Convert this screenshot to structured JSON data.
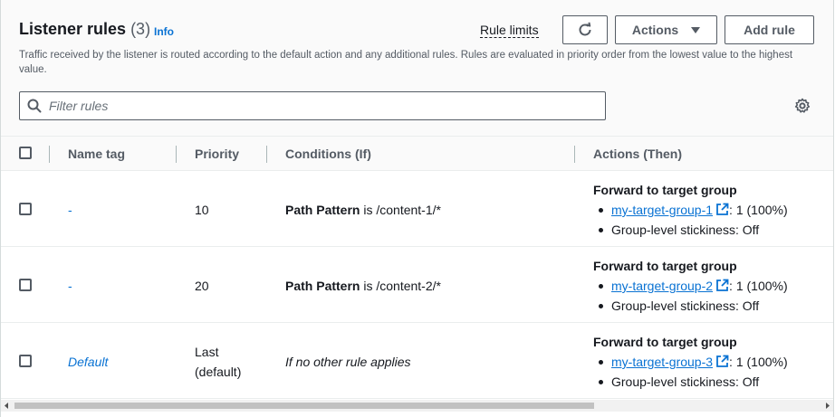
{
  "header": {
    "title": "Listener rules",
    "count": "(3)",
    "info": "Info",
    "rule_limits": "Rule limits",
    "actions_label": "Actions",
    "add_rule_label": "Add rule",
    "description": "Traffic received by the listener is routed according to the default action and any additional rules. Rules are evaluated in priority order from the lowest value to the highest value."
  },
  "filter": {
    "placeholder": "Filter rules",
    "value": ""
  },
  "table": {
    "columns": [
      "Name tag",
      "Priority",
      "Conditions (If)",
      "Actions (Then)"
    ],
    "rows": [
      {
        "name": "-",
        "priority": "10",
        "condition_field": "Path Pattern",
        "condition_rest": " is /content-1/*",
        "action_title": "Forward to target group",
        "target_group": "my-target-group-1",
        "weight": ": 1 (100%)",
        "stickiness": "Group-level stickiness: Off"
      },
      {
        "name": "-",
        "priority": "20",
        "condition_field": "Path Pattern",
        "condition_rest": " is /content-2/*",
        "action_title": "Forward to target group",
        "target_group": "my-target-group-2",
        "weight": ": 1 (100%)",
        "stickiness": "Group-level stickiness: Off"
      },
      {
        "name": "Default",
        "priority_line1": "Last",
        "priority_line2": "(default)",
        "condition_text": "If no other rule applies",
        "action_title": "Forward to target group",
        "target_group": "my-target-group-3",
        "weight": ": 1 (100%)",
        "stickiness": "Group-level stickiness: Off"
      }
    ]
  },
  "colors": {
    "link": "#0972d3",
    "text": "#16191f",
    "muted": "#545b64",
    "header_bg": "#fafafa"
  },
  "icons": [
    "refresh-icon",
    "caret-down-icon",
    "search-icon",
    "settings-gear-icon",
    "external-link-icon",
    "scroll-left-arrow-icon",
    "scroll-right-arrow-icon"
  ]
}
